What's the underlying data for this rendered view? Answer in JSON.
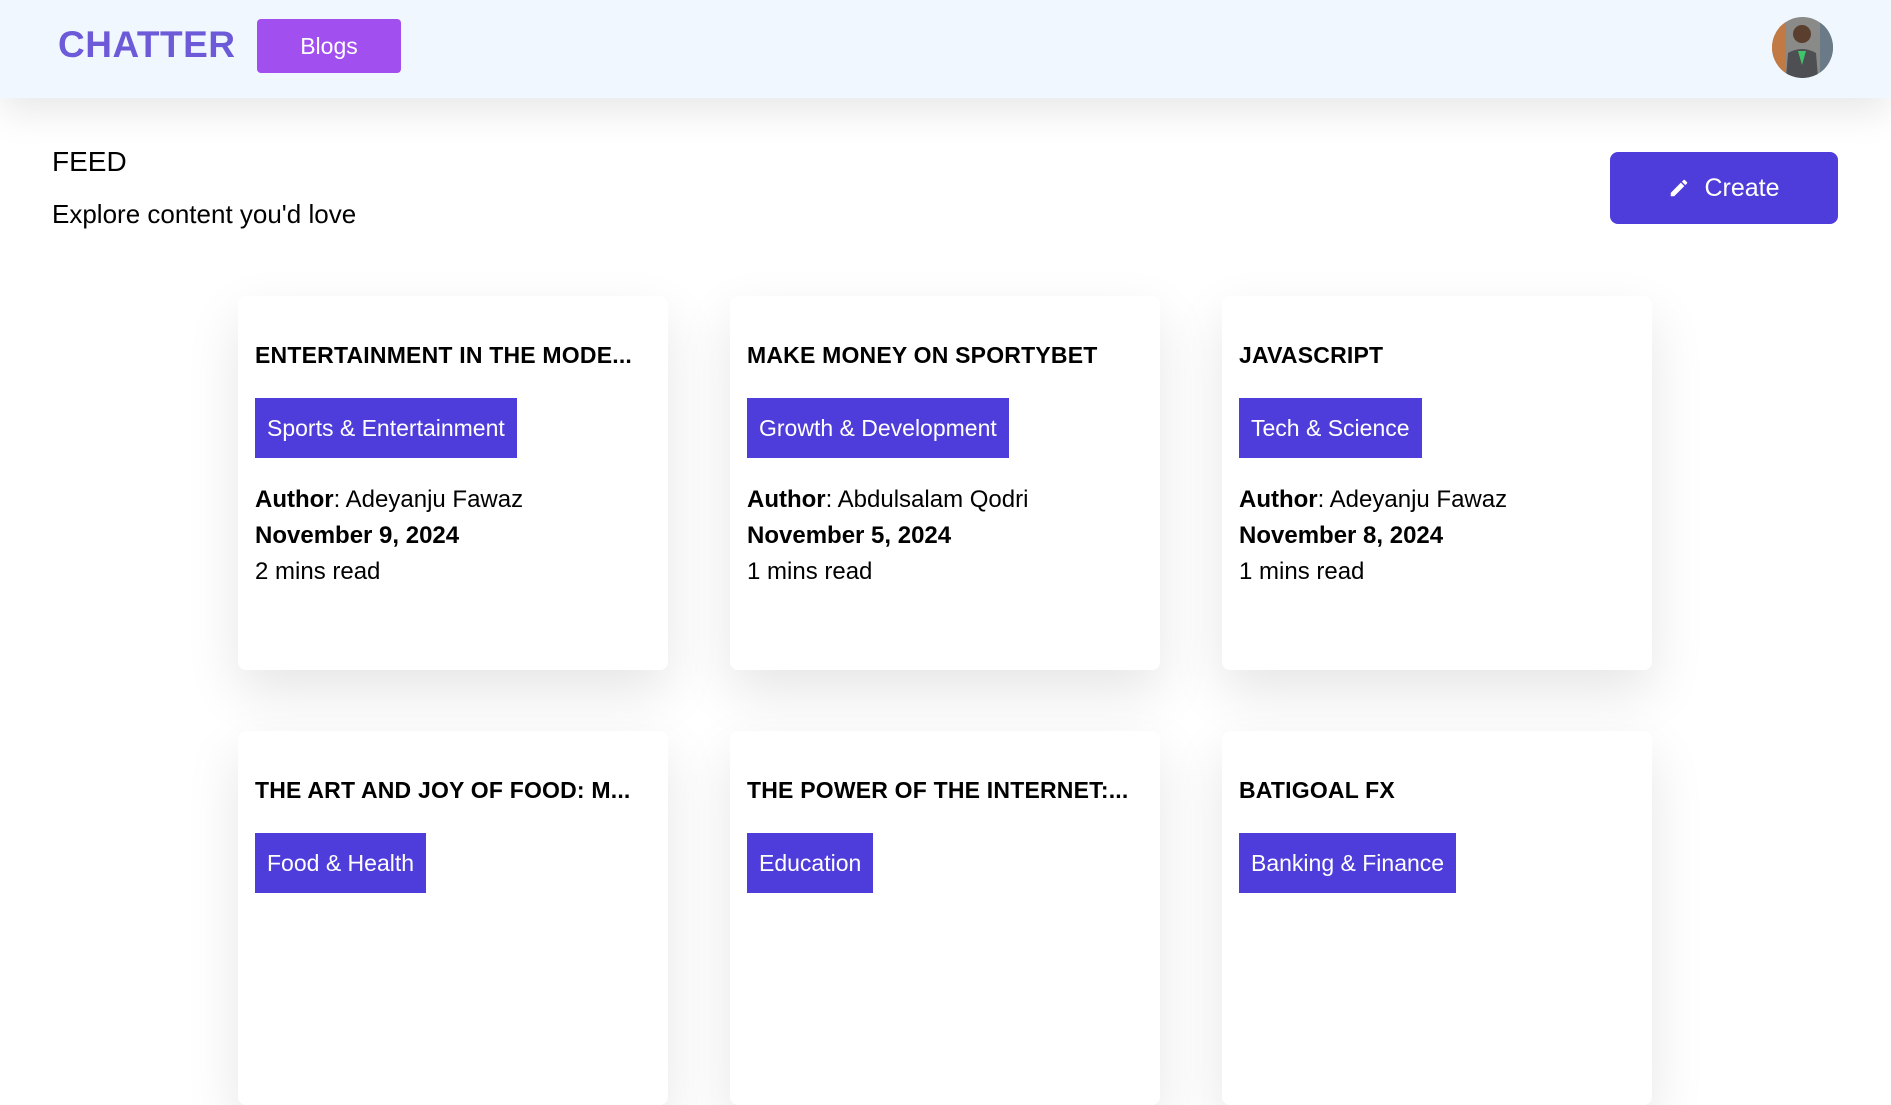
{
  "navbar": {
    "brand": "CHATTER",
    "blogs_label": "Blogs",
    "avatar_icon": "user-avatar"
  },
  "header": {
    "title": "FEED",
    "subtitle": "Explore content you'd love",
    "create_label": "Create",
    "create_icon": "pencil-icon"
  },
  "posts": [
    {
      "title": "ENTERTAINMENT IN THE MODE...",
      "category": "Sports & Entertainment",
      "author_label": "Author",
      "author": ": Adeyanju Fawaz",
      "date": "November 9, 2024",
      "read_time": "2 mins read"
    },
    {
      "title": "MAKE MONEY ON SPORTYBET",
      "category": "Growth & Development",
      "author_label": "Author",
      "author": ": Abdulsalam Qodri",
      "date": "November 5, 2024",
      "read_time": "1 mins read"
    },
    {
      "title": "JAVASCRIPT",
      "category": "Tech & Science",
      "author_label": "Author",
      "author": ": Adeyanju Fawaz",
      "date": "November 8, 2024",
      "read_time": "1 mins read"
    },
    {
      "title": "THE ART AND JOY OF FOOD: M...",
      "category": "Food & Health"
    },
    {
      "title": "THE POWER OF THE INTERNET:...",
      "category": "Education"
    },
    {
      "title": "BATIGOAL FX",
      "category": "Banking & Finance"
    }
  ],
  "colors": {
    "brand": "#6d5ad8",
    "blogs_button": "#a24ff0",
    "accent": "#4f3ddb",
    "navbar_bg": "#f0f7ff"
  }
}
